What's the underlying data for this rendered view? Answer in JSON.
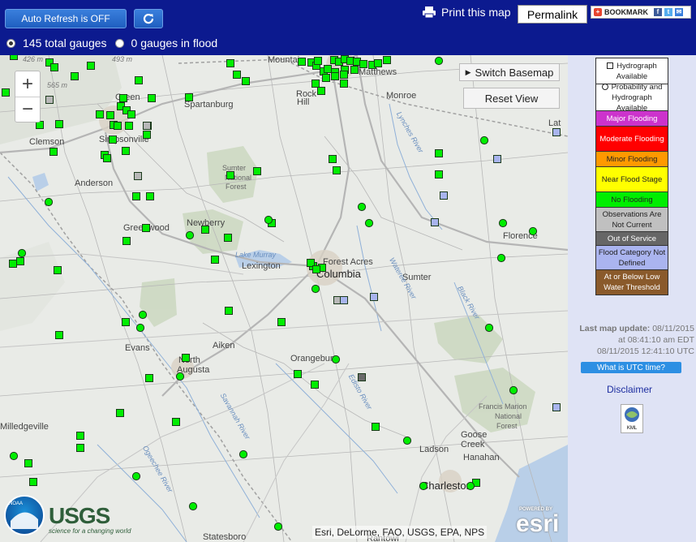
{
  "toolbar": {
    "auto_refresh_label": "Auto Refresh is OFF",
    "reload_icon": "reload-icon",
    "print_label": "Print this map",
    "print_icon": "printer-icon",
    "permalink_label": "Permalink",
    "bookmark_label": "BOOKMARK"
  },
  "gauge_filter": {
    "selected": "total",
    "total_label": "145 total gauges",
    "flood_label": "0 gauges in flood"
  },
  "map": {
    "zoom_in_label": "+",
    "zoom_out_label": "−",
    "switch_basemap_label": "Switch Basemap",
    "reset_view_label": "Reset View",
    "attribution": "Esri, DeLorme, FAO, USGS, EPA, NPS",
    "esri_logo": "esri",
    "powered_by": "POWERED BY",
    "usgs_logo": "USGS",
    "usgs_tagline": "science for a changing world",
    "noaa_logo": "NOAA",
    "place_labels": [
      {
        "text": "Mountain",
        "cls": "city"
      },
      {
        "text": "Matthews",
        "cls": "city"
      },
      {
        "text": "Monroe",
        "cls": "city"
      },
      {
        "text": "Rock",
        "cls": "city"
      },
      {
        "text": "Hill",
        "cls": "city"
      },
      {
        "text": "Spartanburg",
        "cls": "city"
      },
      {
        "text": "Green",
        "cls": "city"
      },
      {
        "text": "Clemson",
        "cls": "city"
      },
      {
        "text": "Simpsonville",
        "cls": "city"
      },
      {
        "text": "Anderson",
        "cls": "city"
      },
      {
        "text": "Sumter",
        "cls": "park"
      },
      {
        "text": "National",
        "cls": "park"
      },
      {
        "text": "Forest",
        "cls": "park"
      },
      {
        "text": "Greenwood",
        "cls": "city"
      },
      {
        "text": "Newberry",
        "cls": "city"
      },
      {
        "text": "Lake Murray",
        "cls": "water"
      },
      {
        "text": "Forest Acres",
        "cls": "city"
      },
      {
        "text": "Lexington",
        "cls": "city"
      },
      {
        "text": "Columbia",
        "cls": "bigcity"
      },
      {
        "text": "Sumter",
        "cls": "city"
      },
      {
        "text": "Florence",
        "cls": "city"
      },
      {
        "text": "Evans",
        "cls": "city"
      },
      {
        "text": "Aiken",
        "cls": "city"
      },
      {
        "text": "North",
        "cls": "city"
      },
      {
        "text": "Augusta",
        "cls": "city"
      },
      {
        "text": "Orangeburg",
        "cls": "city"
      },
      {
        "text": "Francis Marion",
        "cls": "park"
      },
      {
        "text": "National",
        "cls": "park"
      },
      {
        "text": "Forest",
        "cls": "park"
      },
      {
        "text": "Ladson",
        "cls": "city"
      },
      {
        "text": "Goose",
        "cls": "city"
      },
      {
        "text": "Creek",
        "cls": "city"
      },
      {
        "text": "Hanahan",
        "cls": "city"
      },
      {
        "text": "Charleston",
        "cls": "bigcity"
      },
      {
        "text": "Statesboro",
        "cls": "city"
      },
      {
        "text": "Milledgeville",
        "cls": "city"
      },
      {
        "text": "Lynches River",
        "cls": "water"
      },
      {
        "text": "Savannah River",
        "cls": "water"
      },
      {
        "text": "Ogeechee River",
        "cls": "water"
      },
      {
        "text": "Edisto River",
        "cls": "water"
      },
      {
        "text": "Black River",
        "cls": "water"
      },
      {
        "text": "Wateree River",
        "cls": "water"
      },
      {
        "text": "Lat",
        "cls": "city"
      },
      {
        "text": "Rantowl",
        "cls": "city"
      },
      {
        "text": "493 m",
        "cls": "elev"
      },
      {
        "text": "565 m",
        "cls": "elev"
      },
      {
        "text": "426 m",
        "cls": "elev"
      }
    ],
    "gauges": {
      "no_flooding_color": "#00ee00",
      "not_current_color": "#b8b8b8",
      "out_of_service_color": "#6a6a6a",
      "not_defined_color": "#a8b4ee",
      "count_shown": 145
    }
  },
  "legend": {
    "items": [
      {
        "key": "hydrograph",
        "label": "Hydrograph Available",
        "color": "#ffffff",
        "symbol": "square"
      },
      {
        "key": "probability",
        "label": "Probability and Hydrograph Available",
        "color": "#ffffff",
        "symbol": "circle"
      },
      {
        "key": "major",
        "label": "Major Flooding",
        "color": "#cc33cc"
      },
      {
        "key": "moderate",
        "label": "Moderate Flooding",
        "color": "#ff0000"
      },
      {
        "key": "minor",
        "label": "Minor Flooding",
        "color": "#ff9900"
      },
      {
        "key": "near",
        "label": "Near Flood Stage",
        "color": "#ffff00"
      },
      {
        "key": "none",
        "label": "No Flooding",
        "color": "#00ee00"
      },
      {
        "key": "not_current",
        "label": "Observations Are Not Current",
        "color": "#c0c0c0"
      },
      {
        "key": "out_of_service",
        "label": "Out of Service",
        "color": "#666666"
      },
      {
        "key": "not_defined",
        "label": "Flood Category Not Defined",
        "color": "#aab4ef"
      },
      {
        "key": "low_water",
        "label": "At or Below Low Water Threshold",
        "color": "#8a5a2b"
      }
    ]
  },
  "update": {
    "label": "Last map update:",
    "date": "08/11/2015",
    "edt": "at 08:41:10 am EDT",
    "utc": "08/11/2015 12:41:10 UTC",
    "utc_button": "What is UTC time?"
  },
  "disclaimer_label": "Disclaimer",
  "kml_label": "KML"
}
